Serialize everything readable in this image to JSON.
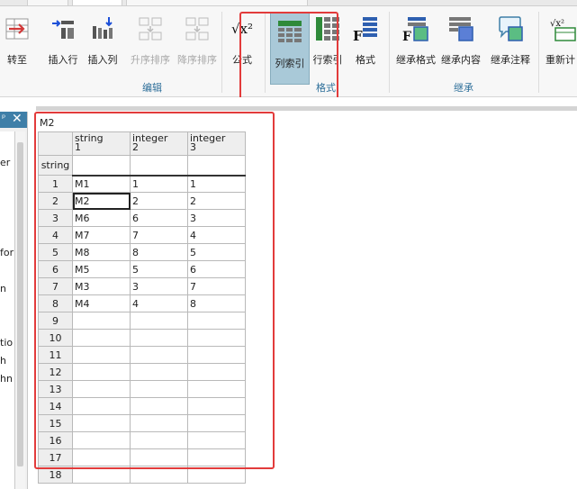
{
  "ribbon": {
    "buttons": [
      {
        "label": "转至",
        "icon": "goto-icon",
        "disabled": false
      },
      {
        "label": "插入行",
        "icon": "insert-row-icon",
        "disabled": false
      },
      {
        "label": "插入列",
        "icon": "insert-column-icon",
        "disabled": false
      },
      {
        "label": "升序排序",
        "icon": "sort-ascending-icon",
        "disabled": true
      },
      {
        "label": "降序排序",
        "icon": "sort-descending-icon",
        "disabled": true
      },
      {
        "label": "公式",
        "icon": "formula-icon",
        "disabled": false
      },
      {
        "label": "列索引",
        "icon": "column-index-icon",
        "disabled": false,
        "active": true
      },
      {
        "label": "行索引",
        "icon": "row-index-icon",
        "disabled": false
      },
      {
        "label": "格式",
        "icon": "format-icon",
        "disabled": false
      },
      {
        "label": "继承格式",
        "icon": "inherit-format-icon",
        "disabled": false
      },
      {
        "label": "继承内容",
        "icon": "inherit-content-icon",
        "disabled": false
      },
      {
        "label": "继承注释",
        "icon": "inherit-comment-icon",
        "disabled": false
      },
      {
        "label": "重新计",
        "icon": "recalculate-icon",
        "disabled": false
      }
    ],
    "groups": {
      "edit": "编辑",
      "format": "格式",
      "inherit": "继承"
    },
    "formula_glyph": "√x²"
  },
  "left_panel": {
    "close": "✕",
    "pin": "ᵖ",
    "fragments": [
      "er",
      "for",
      "n",
      "tio",
      "h",
      "hn"
    ]
  },
  "sheet": {
    "cell_ref": "M2",
    "columns": [
      {
        "type": "string",
        "index": "1"
      },
      {
        "type": "integer",
        "index": "2"
      },
      {
        "type": "integer",
        "index": "3"
      }
    ],
    "row_type_label": "string",
    "rows": [
      {
        "n": "1",
        "cells": [
          "M1",
          "1",
          "1"
        ]
      },
      {
        "n": "2",
        "cells": [
          "M2",
          "2",
          "2"
        ]
      },
      {
        "n": "3",
        "cells": [
          "M6",
          "6",
          "3"
        ]
      },
      {
        "n": "4",
        "cells": [
          "M7",
          "7",
          "4"
        ]
      },
      {
        "n": "5",
        "cells": [
          "M8",
          "8",
          "5"
        ]
      },
      {
        "n": "6",
        "cells": [
          "M5",
          "5",
          "6"
        ]
      },
      {
        "n": "7",
        "cells": [
          "M3",
          "3",
          "7"
        ]
      },
      {
        "n": "8",
        "cells": [
          "M4",
          "4",
          "8"
        ]
      },
      {
        "n": "9",
        "cells": [
          "",
          "",
          ""
        ]
      },
      {
        "n": "10",
        "cells": [
          "",
          "",
          ""
        ]
      },
      {
        "n": "11",
        "cells": [
          "",
          "",
          ""
        ]
      },
      {
        "n": "12",
        "cells": [
          "",
          "",
          ""
        ]
      },
      {
        "n": "13",
        "cells": [
          "",
          "",
          ""
        ]
      },
      {
        "n": "14",
        "cells": [
          "",
          "",
          ""
        ]
      },
      {
        "n": "15",
        "cells": [
          "",
          "",
          ""
        ]
      },
      {
        "n": "16",
        "cells": [
          "",
          "",
          ""
        ]
      },
      {
        "n": "17",
        "cells": [
          "",
          "",
          ""
        ]
      },
      {
        "n": "18",
        "cells": [
          "",
          "",
          ""
        ]
      }
    ]
  },
  "colors": {
    "accent": "#3f7fa8",
    "highlight_box": "#e23b3b",
    "active_button": "#a9c9d8"
  }
}
